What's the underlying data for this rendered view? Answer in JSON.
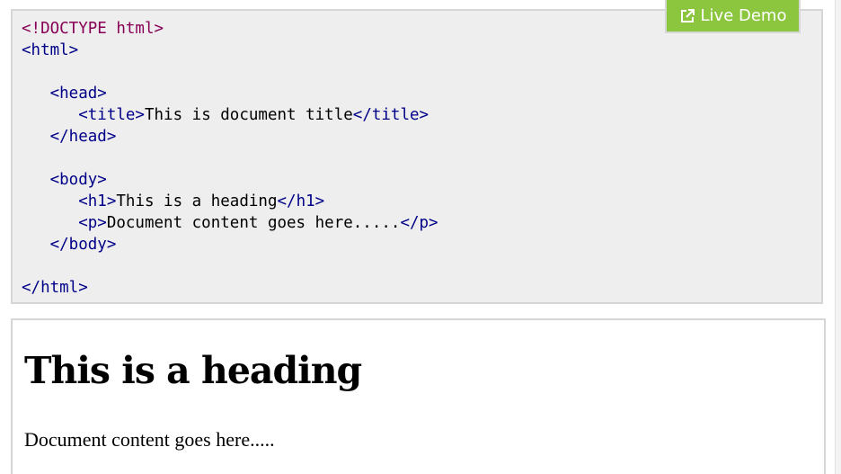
{
  "live_demo": {
    "label": "Live Demo",
    "icon": "external-link-icon",
    "color": "#8cc63f"
  },
  "code_lines": [
    {
      "parts": [
        {
          "t": "<!DOCTYPE html>",
          "c": "doctype"
        }
      ]
    },
    {
      "parts": [
        {
          "t": "<html>",
          "c": "tag"
        }
      ]
    },
    {
      "parts": []
    },
    {
      "parts": [
        {
          "t": "   ",
          "c": "txt"
        },
        {
          "t": "<head>",
          "c": "tag"
        }
      ]
    },
    {
      "parts": [
        {
          "t": "      ",
          "c": "txt"
        },
        {
          "t": "<title>",
          "c": "tag"
        },
        {
          "t": "This is document title",
          "c": "txt"
        },
        {
          "t": "</title>",
          "c": "tag"
        }
      ]
    },
    {
      "parts": [
        {
          "t": "   ",
          "c": "txt"
        },
        {
          "t": "</head>",
          "c": "tag"
        }
      ]
    },
    {
      "parts": []
    },
    {
      "parts": [
        {
          "t": "   ",
          "c": "txt"
        },
        {
          "t": "<body>",
          "c": "tag"
        }
      ]
    },
    {
      "parts": [
        {
          "t": "      ",
          "c": "txt"
        },
        {
          "t": "<h1>",
          "c": "tag"
        },
        {
          "t": "This is a heading",
          "c": "txt"
        },
        {
          "t": "</h1>",
          "c": "tag"
        }
      ]
    },
    {
      "parts": [
        {
          "t": "      ",
          "c": "txt"
        },
        {
          "t": "<p>",
          "c": "tag"
        },
        {
          "t": "Document content goes here.....",
          "c": "txt"
        },
        {
          "t": "</p>",
          "c": "tag"
        }
      ]
    },
    {
      "parts": [
        {
          "t": "   ",
          "c": "txt"
        },
        {
          "t": "</body>",
          "c": "tag"
        }
      ]
    },
    {
      "parts": []
    },
    {
      "parts": [
        {
          "t": "</html>",
          "c": "tag"
        }
      ]
    }
  ],
  "result": {
    "heading": "This is a heading",
    "paragraph": "Document content goes here....."
  }
}
